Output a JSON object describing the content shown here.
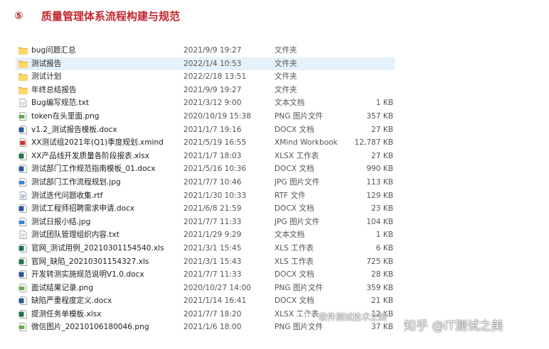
{
  "header": {
    "number": "⑤",
    "title": "质量管理体系流程构建与规范"
  },
  "files": [
    {
      "icon": "folder-icon",
      "name": "bug问题汇总",
      "date": "2021/9/9 19:27",
      "type": "文件夹",
      "size": ""
    },
    {
      "icon": "folder-icon",
      "name": "测试报告",
      "date": "2022/1/4 10:53",
      "type": "文件夹",
      "size": ""
    },
    {
      "icon": "folder-icon",
      "name": "测试计划",
      "date": "2022/2/18 13:51",
      "type": "文件夹",
      "size": ""
    },
    {
      "icon": "folder-icon",
      "name": "年终总结报告",
      "date": "2021/9/9 19:27",
      "type": "文件夹",
      "size": ""
    },
    {
      "icon": "txt-file-icon",
      "name": "Bug编写规范.txt",
      "date": "2021/3/12 9:00",
      "type": "文本文档",
      "size": "1 KB"
    },
    {
      "icon": "png-file-icon",
      "name": "token在头里面.png",
      "date": "2020/10/19 15:38",
      "type": "PNG 图片文件",
      "size": "357 KB"
    },
    {
      "icon": "docx-file-icon",
      "name": "v1.2_测试报告模板.docx",
      "date": "2021/1/7 19:16",
      "type": "DOCX 文档",
      "size": "27 KB"
    },
    {
      "icon": "xmind-file-icon",
      "name": "XX测试组2021年(Q1)季度规划.xmind",
      "date": "2021/5/19 16:55",
      "type": "XMind Workbook",
      "size": "12,787 KB"
    },
    {
      "icon": "xlsx-file-icon",
      "name": "XX产品线开发质量各阶段报表.xlsx",
      "date": "2021/1/7 18:03",
      "type": "XLSX 工作表",
      "size": "27 KB"
    },
    {
      "icon": "docx-file-icon",
      "name": "测试部门工作规范指南模板_01.docx",
      "date": "2021/5/16 10:36",
      "type": "DOCX 文档",
      "size": "990 KB"
    },
    {
      "icon": "jpg-file-icon",
      "name": "测试部门工作流程规划.jpg",
      "date": "2021/7/7 10:46",
      "type": "JPG 图片文件",
      "size": "113 KB"
    },
    {
      "icon": "rtf-file-icon",
      "name": "测试迭代问题收集.rtf",
      "date": "2021/1/30 10:33",
      "type": "RTF 文件",
      "size": "129 KB"
    },
    {
      "icon": "docx-file-icon",
      "name": "测试工程师招聘需求申请.docx",
      "date": "2021/6/8 21:59",
      "type": "DOCX 文档",
      "size": "23 KB"
    },
    {
      "icon": "jpg-file-icon",
      "name": "测试日报小结.jpg",
      "date": "2021/7/7 11:33",
      "type": "JPG 图片文件",
      "size": "104 KB"
    },
    {
      "icon": "txt-file-icon",
      "name": "测试团队管理组织内容.txt",
      "date": "2021/1/29 9:29",
      "type": "文本文档",
      "size": "1 KB"
    },
    {
      "icon": "xls-file-icon",
      "name": "官网_测试用例_20210301154540.xls",
      "date": "2021/3/1 15:45",
      "type": "XLS 工作表",
      "size": "6 KB"
    },
    {
      "icon": "xls-file-icon",
      "name": "官网_缺陷_20210301154327.xls",
      "date": "2021/3/1 15:43",
      "type": "XLS 工作表",
      "size": "725 KB"
    },
    {
      "icon": "docx-file-icon",
      "name": "开发转测实施规范说明V1.0.docx",
      "date": "2021/7/7 11:33",
      "type": "DOCX 文档",
      "size": "28 KB"
    },
    {
      "icon": "png-file-icon",
      "name": "面试结果记录.png",
      "date": "2020/10/27 14:00",
      "type": "PNG 图片文件",
      "size": "359 KB"
    },
    {
      "icon": "docx-file-icon",
      "name": "缺陷严重程度定义.docx",
      "date": "2021/1/14 16:41",
      "type": "DOCX 文档",
      "size": "21 KB"
    },
    {
      "icon": "xlsx-file-icon",
      "name": "提测任务单模板.xlsx",
      "date": "2021/7/7 18:20",
      "type": "XLSX 工作表",
      "size": "12 KB"
    },
    {
      "icon": "png-file-icon",
      "name": "微信图片_20210106180046.png",
      "date": "2021/1/6 18:00",
      "type": "PNG 图片文件",
      "size": "37 KB"
    }
  ],
  "watermark": {
    "account": "软件测试技术之美",
    "zhihu": "知乎 @IT测试之美"
  },
  "colors": {
    "title": "#c0262d",
    "folder": "#f3c74f",
    "selection": "#e5f1fb",
    "word": "#2b579a",
    "excel": "#217346",
    "image": "#6aa84f",
    "xmind": "#d93025"
  }
}
